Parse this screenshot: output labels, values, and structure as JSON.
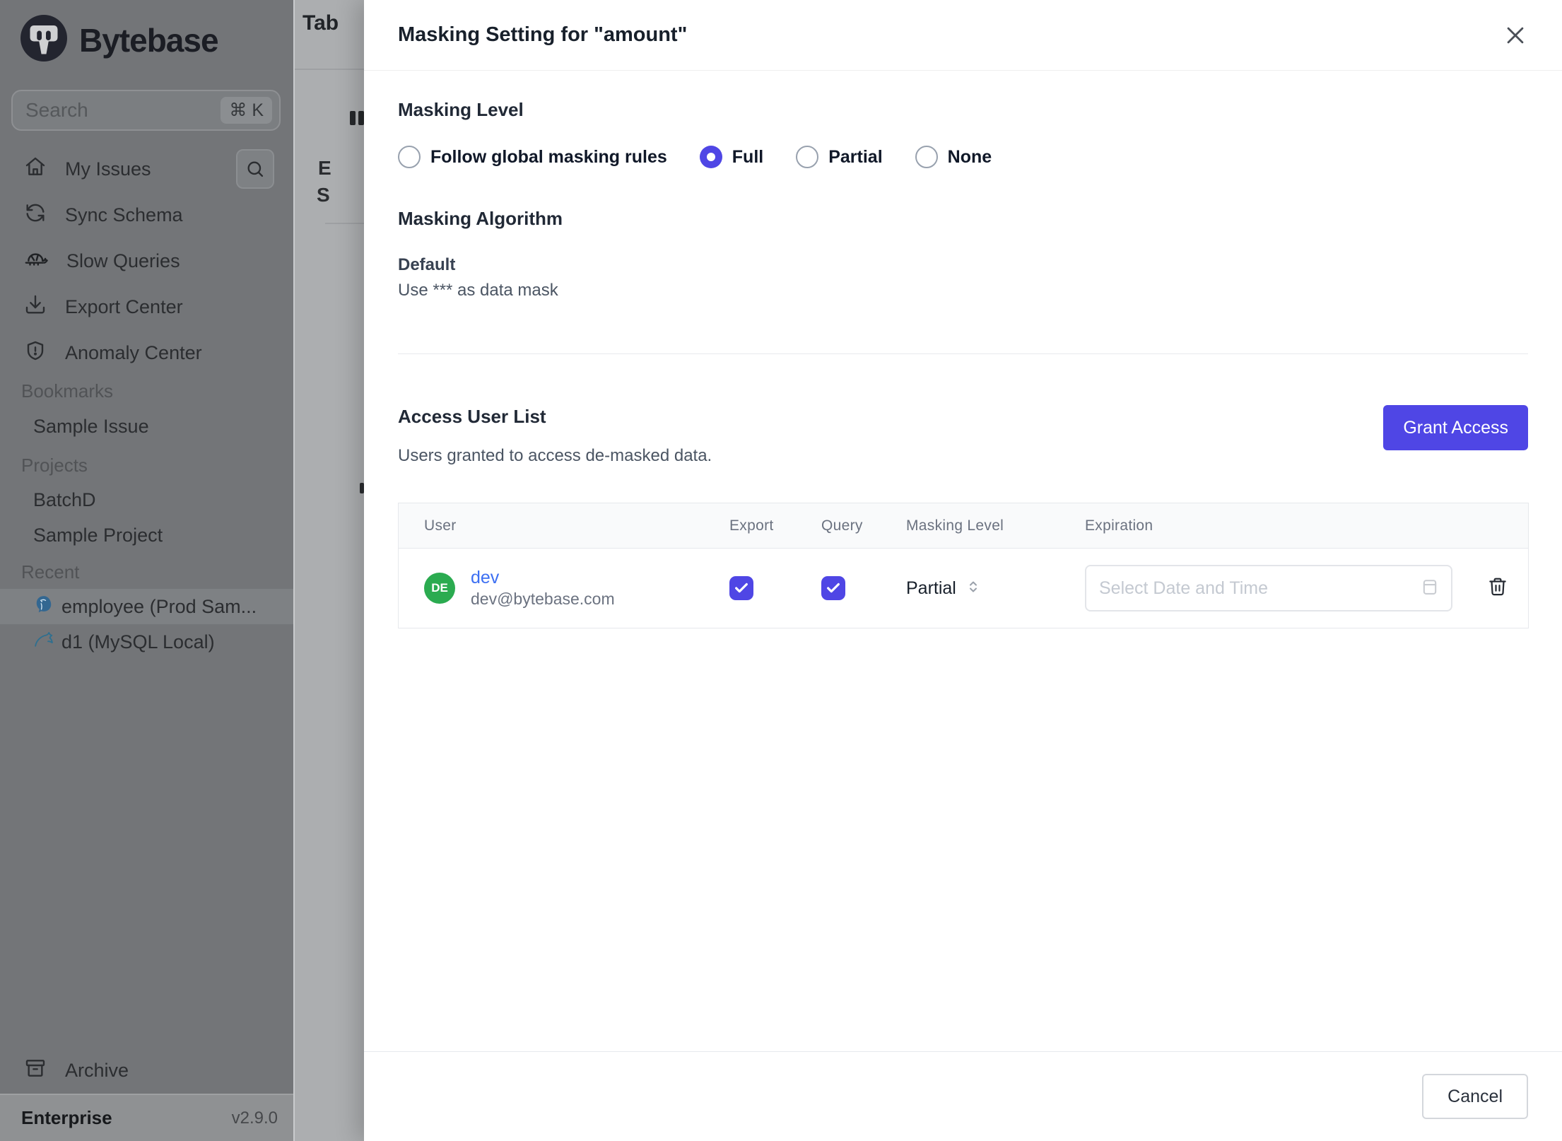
{
  "sidebar": {
    "brand": "Bytebase",
    "search": {
      "placeholder": "Search",
      "shortcut": "⌘ K"
    },
    "nav": [
      {
        "label": "My Issues",
        "icon": "home-icon"
      },
      {
        "label": "Sync Schema",
        "icon": "sync-icon"
      },
      {
        "label": "Slow Queries",
        "icon": "turtle-icon"
      },
      {
        "label": "Export Center",
        "icon": "download-icon"
      },
      {
        "label": "Anomaly Center",
        "icon": "shield-icon"
      }
    ],
    "sections": [
      {
        "label": "Bookmarks",
        "items": [
          {
            "label": "Sample Issue"
          }
        ]
      },
      {
        "label": "Projects",
        "items": [
          {
            "label": "BatchD"
          },
          {
            "label": "Sample Project"
          }
        ]
      },
      {
        "label": "Recent",
        "items": [
          {
            "label": "employee (Prod Sam...",
            "icon": "postgresql-icon",
            "selected": true
          },
          {
            "label": "d1 (MySQL Local)",
            "icon": "mysql-icon",
            "selected": false
          }
        ]
      }
    ],
    "archive_label": "Archive",
    "footer": {
      "plan": "Enterprise",
      "version": "v2.9.0"
    }
  },
  "background_page": {
    "title_fragment": "Tab",
    "fragments": {
      "e": "E",
      "s": "S"
    }
  },
  "modal": {
    "title": "Masking Setting for \"amount\"",
    "masking_level": {
      "heading": "Masking Level",
      "options": [
        {
          "label": "Follow global masking rules",
          "selected": false
        },
        {
          "label": "Full",
          "selected": true
        },
        {
          "label": "Partial",
          "selected": false
        },
        {
          "label": "None",
          "selected": false
        }
      ]
    },
    "masking_algorithm": {
      "heading": "Masking Algorithm",
      "name": "Default",
      "description": "Use *** as data mask"
    },
    "access_user_list": {
      "heading": "Access User List",
      "description": "Users granted to access de-masked data.",
      "grant_button": "Grant Access",
      "table": {
        "columns": [
          "User",
          "Export",
          "Query",
          "Masking Level",
          "Expiration"
        ],
        "rows": [
          {
            "avatar_initials": "DE",
            "name": "dev",
            "email": "dev@bytebase.com",
            "export_checked": true,
            "query_checked": true,
            "masking_level": "Partial",
            "expiration_placeholder": "Select Date and Time"
          }
        ]
      }
    },
    "cancel_button": "Cancel"
  },
  "colors": {
    "accent": "#4f46e5",
    "avatar_green": "#2bab50",
    "link_blue": "#3c6ff2"
  }
}
